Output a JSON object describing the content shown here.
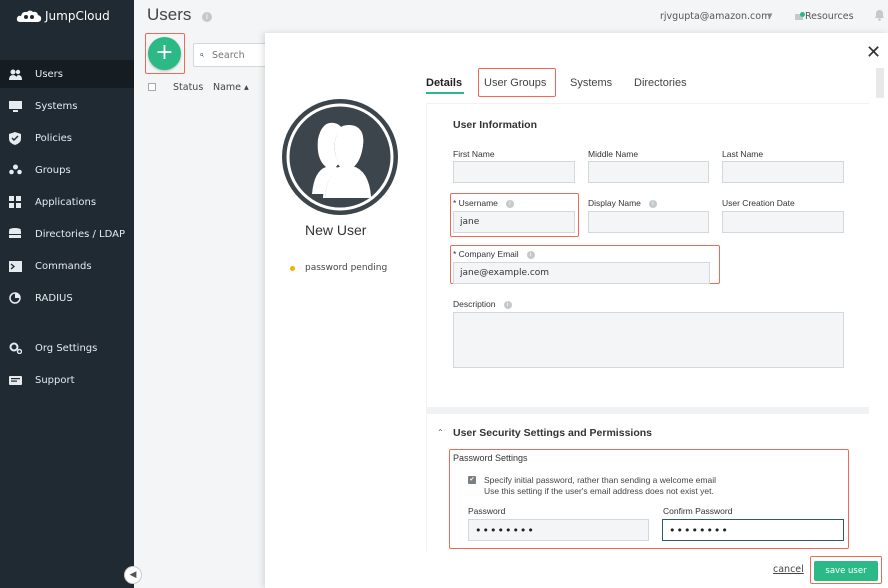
{
  "app": {
    "brand": "JumpCloud"
  },
  "sidebar": {
    "items": [
      {
        "label": "Users",
        "icon": "users-icon"
      },
      {
        "label": "Systems",
        "icon": "systems-icon"
      },
      {
        "label": "Policies",
        "icon": "policies-icon"
      },
      {
        "label": "Groups",
        "icon": "groups-icon"
      },
      {
        "label": "Applications",
        "icon": "applications-icon"
      },
      {
        "label": "Directories / LDAP",
        "icon": "directories-icon"
      },
      {
        "label": "Commands",
        "icon": "commands-icon"
      },
      {
        "label": "RADIUS",
        "icon": "radius-icon"
      },
      {
        "label": "Org Settings",
        "icon": "org-settings-icon"
      },
      {
        "label": "Support",
        "icon": "support-icon"
      }
    ]
  },
  "header": {
    "title": "Users",
    "user_email": "rjvgupta@amazon.com",
    "resources": "Resources"
  },
  "list": {
    "search_placeholder": "Search",
    "col_status": "Status",
    "col_name": "Name ▴"
  },
  "modal": {
    "new_user": "New User",
    "status_text": "password pending",
    "tabs": [
      "Details",
      "User Groups",
      "Systems",
      "Directories"
    ],
    "user_info": {
      "title": "User Information",
      "first_name_label": "First Name",
      "middle_name_label": "Middle Name",
      "last_name_label": "Last Name",
      "username_label": "* Username",
      "username_value": "jane",
      "display_name_label": "Display Name",
      "creation_date_label": "User Creation Date",
      "company_email_label": "* Company Email",
      "company_email_value": "jane@example.com",
      "description_label": "Description"
    },
    "security": {
      "title": "User Security Settings and Permissions",
      "password_settings": "Password Settings",
      "checkbox_line1": "Specify initial password, rather than sending a welcome email",
      "checkbox_line2": "Use this setting if the user's email address does not exist yet.",
      "password_label": "Password",
      "password_value": "••••••••",
      "confirm_label": "Confirm Password",
      "confirm_value": "••••••••"
    },
    "cancel": "cancel",
    "save": "save user"
  },
  "colors": {
    "accent_green": "#2bba86",
    "sidebar_bg": "#1f2a33",
    "highlight": "#ec6b52",
    "pending": "#f0b400"
  }
}
